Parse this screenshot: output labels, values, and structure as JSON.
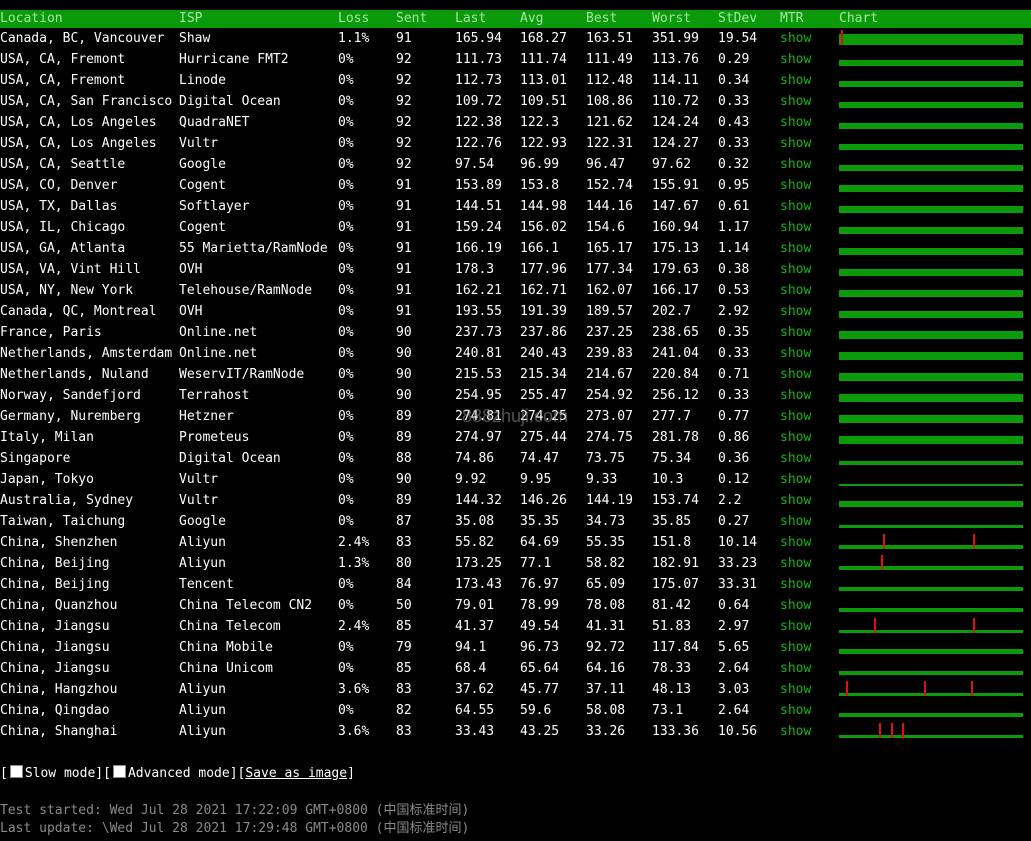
{
  "header": {
    "location": "Location",
    "isp": "ISP",
    "loss": "Loss",
    "sent": "Sent",
    "last": "Last",
    "avg": "Avg",
    "best": "Best",
    "worst": "Worst",
    "stdev": "StDev",
    "mtr": "MTR",
    "chart": "Chart"
  },
  "rows": [
    {
      "location": "Canada, BC, Vancouver",
      "isp": "Shaw",
      "loss": "1.1%",
      "sent": "91",
      "last": "165.94",
      "avg": "168.27",
      "best": "163.51",
      "worst": "351.99",
      "stdev": "19.54",
      "mtr": "show",
      "chart": {
        "level": 0.9,
        "spikes": [
          0.01
        ]
      }
    },
    {
      "location": "USA, CA, Fremont",
      "isp": "Hurricane FMT2",
      "loss": "0%",
      "sent": "92",
      "last": "111.73",
      "avg": "111.74",
      "best": "111.49",
      "worst": "113.76",
      "stdev": "0.29",
      "mtr": "show",
      "chart": {
        "level": 0.5,
        "spikes": []
      }
    },
    {
      "location": "USA, CA, Fremont",
      "isp": "Linode",
      "loss": "0%",
      "sent": "92",
      "last": "112.73",
      "avg": "113.01",
      "best": "112.48",
      "worst": "114.11",
      "stdev": "0.34",
      "mtr": "show",
      "chart": {
        "level": 0.5,
        "spikes": []
      }
    },
    {
      "location": "USA, CA, San Francisco",
      "isp": "Digital Ocean",
      "loss": "0%",
      "sent": "92",
      "last": "109.72",
      "avg": "109.51",
      "best": "108.86",
      "worst": "110.72",
      "stdev": "0.33",
      "mtr": "show",
      "chart": {
        "level": 0.5,
        "spikes": []
      }
    },
    {
      "location": "USA, CA, Los Angeles",
      "isp": "QuadraNET",
      "loss": "0%",
      "sent": "92",
      "last": "122.38",
      "avg": "122.3",
      "best": "121.62",
      "worst": "124.24",
      "stdev": "0.43",
      "mtr": "show",
      "chart": {
        "level": 0.5,
        "spikes": []
      }
    },
    {
      "location": "USA, CA, Los Angeles",
      "isp": "Vultr",
      "loss": "0%",
      "sent": "92",
      "last": "122.76",
      "avg": "122.93",
      "best": "122.31",
      "worst": "124.27",
      "stdev": "0.33",
      "mtr": "show",
      "chart": {
        "level": 0.5,
        "spikes": []
      }
    },
    {
      "location": "USA, CA, Seattle",
      "isp": "Google",
      "loss": "0%",
      "sent": "92",
      "last": "97.54",
      "avg": "96.99",
      "best": "96.47",
      "worst": "97.62",
      "stdev": "0.32",
      "mtr": "show",
      "chart": {
        "level": 0.5,
        "spikes": []
      }
    },
    {
      "location": "USA, CO, Denver",
      "isp": "Cogent",
      "loss": "0%",
      "sent": "91",
      "last": "153.89",
      "avg": "153.8",
      "best": "152.74",
      "worst": "155.91",
      "stdev": "0.95",
      "mtr": "show",
      "chart": {
        "level": 0.55,
        "spikes": []
      }
    },
    {
      "location": "USA, TX, Dallas",
      "isp": "Softlayer",
      "loss": "0%",
      "sent": "91",
      "last": "144.51",
      "avg": "144.98",
      "best": "144.16",
      "worst": "147.67",
      "stdev": "0.61",
      "mtr": "show",
      "chart": {
        "level": 0.55,
        "spikes": []
      }
    },
    {
      "location": "USA, IL, Chicago",
      "isp": "Cogent",
      "loss": "0%",
      "sent": "91",
      "last": "159.24",
      "avg": "156.02",
      "best": "154.6",
      "worst": "160.94",
      "stdev": "1.17",
      "mtr": "show",
      "chart": {
        "level": 0.55,
        "spikes": []
      }
    },
    {
      "location": "USA, GA, Atlanta",
      "isp": "55 Marietta/RamNode",
      "loss": "0%",
      "sent": "91",
      "last": "166.19",
      "avg": "166.1",
      "best": "165.17",
      "worst": "175.13",
      "stdev": "1.14",
      "mtr": "show",
      "chart": {
        "level": 0.55,
        "spikes": []
      }
    },
    {
      "location": "USA, VA, Vint Hill",
      "isp": "OVH",
      "loss": "0%",
      "sent": "91",
      "last": "178.3",
      "avg": "177.96",
      "best": "177.34",
      "worst": "179.63",
      "stdev": "0.38",
      "mtr": "show",
      "chart": {
        "level": 0.55,
        "spikes": []
      }
    },
    {
      "location": "USA, NY, New York",
      "isp": "Telehouse/RamNode",
      "loss": "0%",
      "sent": "91",
      "last": "162.21",
      "avg": "162.71",
      "best": "162.07",
      "worst": "166.17",
      "stdev": "0.53",
      "mtr": "show",
      "chart": {
        "level": 0.55,
        "spikes": []
      }
    },
    {
      "location": "Canada, QC, Montreal",
      "isp": "OVH",
      "loss": "0%",
      "sent": "91",
      "last": "193.55",
      "avg": "191.39",
      "best": "189.57",
      "worst": "202.7",
      "stdev": "2.92",
      "mtr": "show",
      "chart": {
        "level": 0.6,
        "spikes": []
      }
    },
    {
      "location": "France, Paris",
      "isp": "Online.net",
      "loss": "0%",
      "sent": "90",
      "last": "237.73",
      "avg": "237.86",
      "best": "237.25",
      "worst": "238.65",
      "stdev": "0.35",
      "mtr": "show",
      "chart": {
        "level": 0.65,
        "spikes": []
      }
    },
    {
      "location": "Netherlands, Amsterdam",
      "isp": "Online.net",
      "loss": "0%",
      "sent": "90",
      "last": "240.81",
      "avg": "240.43",
      "best": "239.83",
      "worst": "241.04",
      "stdev": "0.33",
      "mtr": "show",
      "chart": {
        "level": 0.65,
        "spikes": []
      }
    },
    {
      "location": "Netherlands, Nuland",
      "isp": "WeservIT/RamNode",
      "loss": "0%",
      "sent": "90",
      "last": "215.53",
      "avg": "215.34",
      "best": "214.67",
      "worst": "220.84",
      "stdev": "0.71",
      "mtr": "show",
      "chart": {
        "level": 0.65,
        "spikes": []
      }
    },
    {
      "location": "Norway, Sandefjord",
      "isp": "Terrahost",
      "loss": "0%",
      "sent": "90",
      "last": "254.95",
      "avg": "255.47",
      "best": "254.92",
      "worst": "256.12",
      "stdev": "0.33",
      "mtr": "show",
      "chart": {
        "level": 0.7,
        "spikes": []
      }
    },
    {
      "location": "Germany, Nuremberg",
      "isp": "Hetzner",
      "loss": "0%",
      "sent": "89",
      "last": "274.81",
      "avg": "274.25",
      "best": "273.07",
      "worst": "277.7",
      "stdev": "0.77",
      "mtr": "show",
      "chart": {
        "level": 0.7,
        "spikes": []
      }
    },
    {
      "location": "Italy, Milan",
      "isp": "Prometeus",
      "loss": "0%",
      "sent": "89",
      "last": "274.97",
      "avg": "275.44",
      "best": "274.75",
      "worst": "281.78",
      "stdev": "0.86",
      "mtr": "show",
      "chart": {
        "level": 0.7,
        "spikes": []
      }
    },
    {
      "location": "Singapore",
      "isp": "Digital Ocean",
      "loss": "0%",
      "sent": "88",
      "last": "74.86",
      "avg": "74.47",
      "best": "73.75",
      "worst": "75.34",
      "stdev": "0.36",
      "mtr": "show",
      "chart": {
        "level": 0.35,
        "spikes": []
      }
    },
    {
      "location": "Japan, Tokyo",
      "isp": "Vultr",
      "loss": "0%",
      "sent": "90",
      "last": "9.92",
      "avg": "9.95",
      "best": "9.33",
      "worst": "10.3",
      "stdev": "0.12",
      "mtr": "show",
      "chart": {
        "level": 0.1,
        "spikes": []
      }
    },
    {
      "location": "Australia, Sydney",
      "isp": "Vultr",
      "loss": "0%",
      "sent": "89",
      "last": "144.32",
      "avg": "146.26",
      "best": "144.19",
      "worst": "153.74",
      "stdev": "2.2",
      "mtr": "show",
      "chart": {
        "level": 0.5,
        "spikes": []
      }
    },
    {
      "location": "Taiwan, Taichung",
      "isp": "Google",
      "loss": "0%",
      "sent": "87",
      "last": "35.08",
      "avg": "35.35",
      "best": "34.73",
      "worst": "35.85",
      "stdev": "0.27",
      "mtr": "show",
      "chart": {
        "level": 0.25,
        "spikes": []
      }
    },
    {
      "location": "China, Shenzhen",
      "isp": "Aliyun",
      "loss": "2.4%",
      "sent": "83",
      "last": "55.82",
      "avg": "64.69",
      "best": "55.35",
      "worst": "151.8",
      "stdev": "10.14",
      "mtr": "show",
      "chart": {
        "level": 0.3,
        "spikes": [
          0.24,
          0.73
        ]
      }
    },
    {
      "location": "China, Beijing",
      "isp": "Aliyun",
      "loss": "1.3%",
      "sent": "80",
      "last": "173.25",
      "avg": "77.1",
      "best": "58.82",
      "worst": "182.91",
      "stdev": "33.23",
      "mtr": "show",
      "chart": {
        "level": 0.35,
        "spikes": [
          0.23
        ]
      }
    },
    {
      "location": "China, Beijing",
      "isp": "Tencent",
      "loss": "0%",
      "sent": "84",
      "last": "173.43",
      "avg": "76.97",
      "best": "65.09",
      "worst": "175.07",
      "stdev": "33.31",
      "mtr": "show",
      "chart": {
        "level": 0.35,
        "spikes": []
      }
    },
    {
      "location": "China, Quanzhou",
      "isp": "China Telecom CN2",
      "loss": "0%",
      "sent": "50",
      "last": "79.01",
      "avg": "78.99",
      "best": "78.08",
      "worst": "81.42",
      "stdev": "0.64",
      "mtr": "show",
      "chart": {
        "level": 0.35,
        "spikes": []
      }
    },
    {
      "location": "China, Jiangsu",
      "isp": "China Telecom",
      "loss": "2.4%",
      "sent": "85",
      "last": "41.37",
      "avg": "49.54",
      "best": "41.31",
      "worst": "51.83",
      "stdev": "2.97",
      "mtr": "show",
      "chart": {
        "level": 0.25,
        "spikes": [
          0.19,
          0.73
        ]
      }
    },
    {
      "location": "China, Jiangsu",
      "isp": "China Mobile",
      "loss": "0%",
      "sent": "79",
      "last": "94.1",
      "avg": "96.73",
      "best": "92.72",
      "worst": "117.84",
      "stdev": "5.65",
      "mtr": "show",
      "chart": {
        "level": 0.4,
        "spikes": []
      }
    },
    {
      "location": "China, Jiangsu",
      "isp": "China Unicom",
      "loss": "0%",
      "sent": "85",
      "last": "68.4",
      "avg": "65.64",
      "best": "64.16",
      "worst": "78.33",
      "stdev": "2.64",
      "mtr": "show",
      "chart": {
        "level": 0.35,
        "spikes": []
      }
    },
    {
      "location": "China, Hangzhou",
      "isp": "Aliyun",
      "loss": "3.6%",
      "sent": "83",
      "last": "37.62",
      "avg": "45.77",
      "best": "37.11",
      "worst": "48.13",
      "stdev": "3.03",
      "mtr": "show",
      "chart": {
        "level": 0.25,
        "spikes": [
          0.04,
          0.46,
          0.72
        ]
      }
    },
    {
      "location": "China, Qingdao",
      "isp": "Aliyun",
      "loss": "0%",
      "sent": "82",
      "last": "64.55",
      "avg": "59.6",
      "best": "58.08",
      "worst": "73.1",
      "stdev": "2.64",
      "mtr": "show",
      "chart": {
        "level": 0.3,
        "spikes": []
      }
    },
    {
      "location": "China, Shanghai",
      "isp": "Aliyun",
      "loss": "3.6%",
      "sent": "83",
      "last": "33.43",
      "avg": "43.25",
      "best": "33.26",
      "worst": "133.36",
      "stdev": "10.56",
      "mtr": "show",
      "chart": {
        "level": 0.25,
        "spikes": [
          0.22,
          0.28,
          0.34
        ]
      }
    }
  ],
  "controls": {
    "slow_mode": "Slow mode",
    "advanced_mode": "Advanced mode",
    "save_as_image": "Save as image"
  },
  "footer": {
    "test_started": "Test started: Wed Jul 28 2021 17:22:09 GMT+0800 (中国标准时间)",
    "last_update": "Last update: \\Wed Jul 28 2021 17:29:48 GMT+0800 (中国标准时间)"
  },
  "watermark": "888zhuji.com",
  "colors": {
    "header_bg": "#0a9a0a",
    "mtr_link": "#16b416",
    "chart_bar": "#0a9a0a",
    "chart_loss": "#e01010",
    "footer_text": "#8a8a8a"
  }
}
